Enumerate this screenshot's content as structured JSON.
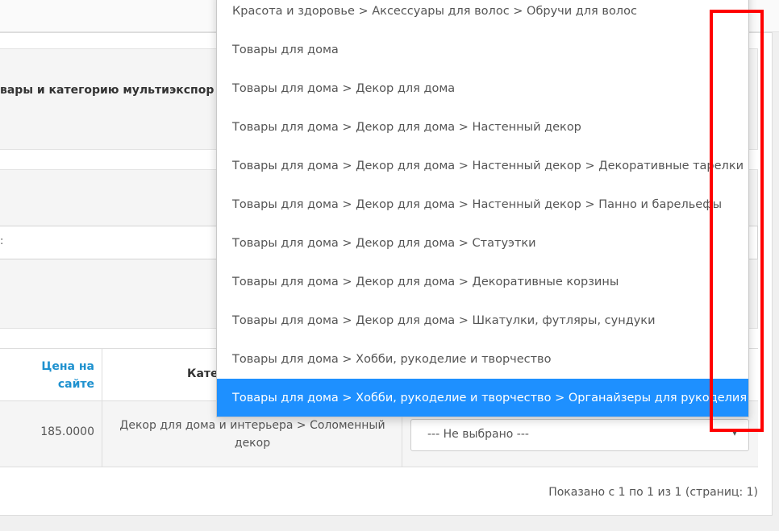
{
  "heading": {
    "title": "вары и категорию мультиэкспор"
  },
  "filter": {
    "input_fragment": ":"
  },
  "table": {
    "headers": {
      "price": "Цена на сайте",
      "category": "Кате"
    },
    "rows": [
      {
        "price": "185.0000",
        "site_category": "Декор для дома и интерьера  >  Соломенный декор",
        "mapped_category": "--- Не выбрано ---"
      }
    ]
  },
  "pagination": {
    "text": "Показано с 1 по 1 из 1 (страниц: 1)"
  },
  "dropdown": {
    "items": [
      "Красота и здоровье > Аксессуары для волос > Обручи для волос",
      "Товары для дома",
      "Товары для дома > Декор для дома",
      "Товары для дома > Декор для дома > Настенный декор",
      "Товары для дома > Декор для дома > Настенный декор > Декоративные тарелки",
      "Товары для дома > Декор для дома > Настенный декор > Панно и барельефы",
      "Товары для дома > Декор для дома > Статуэтки",
      "Товары для дома > Декор для дома > Декоративные корзины",
      "Товары для дома > Декор для дома > Шкатулки, футляры, сундуки",
      "Товары для дома > Хобби, рукоделие и творчество",
      "Товары для дома > Хобби, рукоделие и творчество > Органайзеры для рукоделия"
    ],
    "selected_index": 10
  },
  "colors": {
    "accent": "#1e90ff",
    "link": "#1e91cf",
    "highlight": "#ff0000"
  }
}
